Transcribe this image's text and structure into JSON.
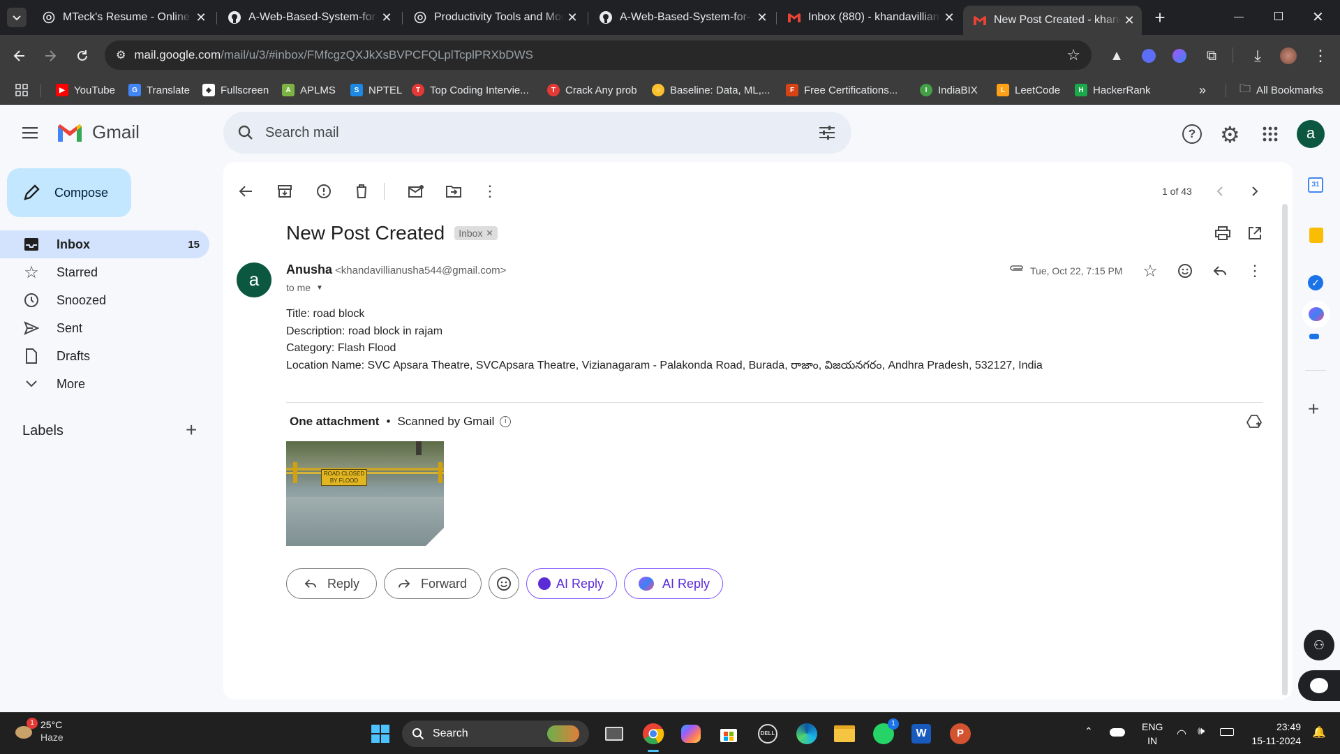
{
  "browser": {
    "tabs": [
      {
        "title": "MTeck's Resume - Online L",
        "icon": "chatgpt-icon"
      },
      {
        "title": "A-Web-Based-System-for-",
        "icon": "github-icon"
      },
      {
        "title": "Productivity Tools and Mor",
        "icon": "chatgpt-icon"
      },
      {
        "title": "A-Web-Based-System-for-",
        "icon": "github-icon"
      },
      {
        "title": "Inbox (880) - khandavillian",
        "icon": "gmail-icon"
      },
      {
        "title": "New Post Created - khand",
        "icon": "gmail-icon"
      }
    ],
    "address": {
      "domain": "mail.google.com",
      "path": "/mail/u/3/#inbox/FMfcgzQXJkXsBVPCFQLplTcplPRXbDWS"
    },
    "bookmarks": [
      {
        "label": "YouTube",
        "color": "#ff0000"
      },
      {
        "label": "Translate",
        "color": "#4285f4"
      },
      {
        "label": "Fullscreen",
        "color": "#ffffff"
      },
      {
        "label": "APLMS",
        "color": "#7cb342"
      },
      {
        "label": "NPTEL",
        "color": "#1e88e5"
      },
      {
        "label": "Top Coding Intervie...",
        "color": "#e53935"
      },
      {
        "label": "Crack Any prob",
        "color": "#e53935"
      },
      {
        "label": "Baseline: Data, ML,...",
        "color": "#fbc02d"
      },
      {
        "label": "Free Certifications...",
        "color": "#d84315"
      },
      {
        "label": "IndiaBIX",
        "color": "#43a047"
      },
      {
        "label": "LeetCode",
        "color": "#ffa116"
      },
      {
        "label": "HackerRank",
        "color": "#1ba94c"
      }
    ],
    "all_bookmarks": "All Bookmarks"
  },
  "gmail": {
    "logo_text": "Gmail",
    "search_placeholder": "Search mail",
    "avatar_letter": "a",
    "compose": "Compose",
    "nav": [
      {
        "label": "Inbox",
        "count": "15",
        "icon": "inbox-icon"
      },
      {
        "label": "Starred",
        "count": "",
        "icon": "star-icon"
      },
      {
        "label": "Snoozed",
        "count": "",
        "icon": "clock-icon"
      },
      {
        "label": "Sent",
        "count": "",
        "icon": "send-icon"
      },
      {
        "label": "Drafts",
        "count": "",
        "icon": "draft-icon"
      },
      {
        "label": "More",
        "count": "",
        "icon": "chevron-down-icon"
      }
    ],
    "labels_heading": "Labels",
    "pagination": "1 of 43",
    "email": {
      "subject": "New Post Created",
      "label_chip": "Inbox",
      "sender_name": "Anusha",
      "sender_email": "<khandavillianusha544@gmail.com>",
      "recipient": "to me",
      "date": "Tue, Oct 22, 7:15 PM",
      "avatar_letter": "a",
      "body": [
        "Title: road block",
        "Description: road block in rajam",
        "Category: Flash Flood",
        "Location Name: SVC Apsara Theatre, SVCApsara Theatre, Vizianagaram - Palakonda Road, Burada, రాజాం, విజయనగరం, Andhra Pradesh, 532127, India"
      ],
      "attachment_heading": "One attachment",
      "scanned": "Scanned by Gmail",
      "sign_text_1": "ROAD CLOSED",
      "sign_text_2": "BY FLOOD"
    },
    "actions": {
      "reply": "Reply",
      "forward": "Forward",
      "ai_reply_1": "AI Reply",
      "ai_reply_2": "AI Reply"
    }
  },
  "taskbar": {
    "weather_temp": "25°C",
    "weather_desc": "Haze",
    "weather_badge": "1",
    "search": "Search",
    "lang_1": "ENG",
    "lang_2": "IN",
    "time": "23:49",
    "date": "15-11-2024",
    "whatsapp_badge": "1"
  },
  "colors": {
    "accent_blue": "#0b57d0",
    "compose_bg": "#c2e7ff",
    "inbox_active_bg": "#d3e3fd",
    "avatar_green": "#0b5740",
    "ai_purple": "#5b2bd6"
  }
}
